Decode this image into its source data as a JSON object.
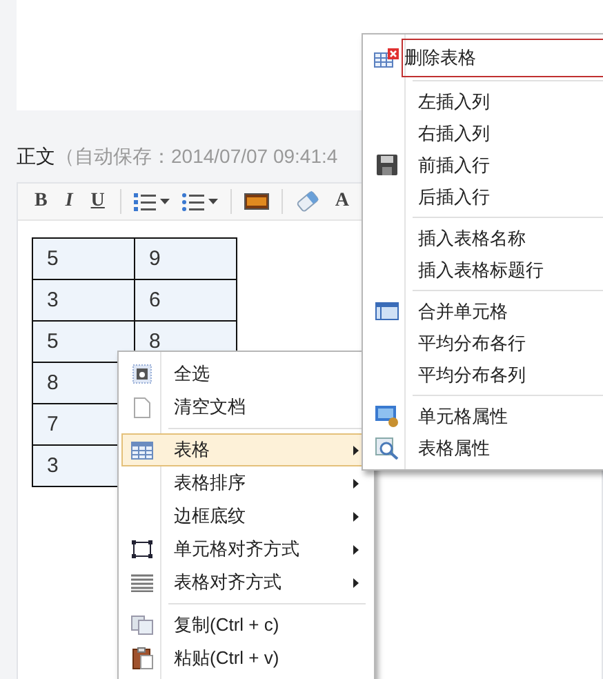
{
  "section": {
    "title": "正文",
    "autosave": "（自动保存：2014/07/07 09:41:4"
  },
  "toolbar": [
    {
      "kind": "text",
      "label": "B"
    },
    {
      "kind": "text",
      "label": "I"
    },
    {
      "kind": "text",
      "label": "U"
    },
    {
      "kind": "separator"
    },
    {
      "kind": "icon"
    },
    {
      "kind": "icon"
    },
    {
      "kind": "separator"
    },
    {
      "kind": "icon"
    },
    {
      "kind": "separator"
    },
    {
      "kind": "icon"
    },
    {
      "kind": "text",
      "label": "A"
    }
  ],
  "table": {
    "rows": [
      [
        "5",
        "9"
      ],
      [
        "3",
        "6"
      ],
      [
        "5",
        "8"
      ],
      [
        "8",
        ""
      ],
      [
        "7",
        ""
      ],
      [
        "3",
        ""
      ]
    ]
  },
  "context_menu": {
    "items": [
      {
        "kind": "item",
        "label": "全选",
        "submenu": false,
        "selected": false
      },
      {
        "kind": "item",
        "label": "清空文档",
        "submenu": false,
        "selected": false
      },
      {
        "kind": "separator"
      },
      {
        "kind": "item",
        "label": "表格",
        "submenu": true,
        "selected": true
      },
      {
        "kind": "item",
        "label": "表格排序",
        "submenu": true,
        "selected": false
      },
      {
        "kind": "item",
        "label": "边框底纹",
        "submenu": true,
        "selected": false
      },
      {
        "kind": "item",
        "label": "单元格对齐方式",
        "submenu": true,
        "selected": false
      },
      {
        "kind": "item",
        "label": "表格对齐方式",
        "submenu": true,
        "selected": false
      },
      {
        "kind": "separator"
      },
      {
        "kind": "item",
        "label": "复制(Ctrl + c)",
        "submenu": false,
        "selected": false
      },
      {
        "kind": "item",
        "label": "粘贴(Ctrl + v)",
        "submenu": false,
        "selected": false
      }
    ]
  },
  "submenu": {
    "items": [
      {
        "kind": "item",
        "label": "删除表格",
        "selected": true
      },
      {
        "kind": "separator"
      },
      {
        "kind": "item",
        "label": "左插入列",
        "selected": false
      },
      {
        "kind": "item",
        "label": "右插入列",
        "selected": false
      },
      {
        "kind": "item",
        "label": "前插入行",
        "selected": false
      },
      {
        "kind": "item",
        "label": "后插入行",
        "selected": false
      },
      {
        "kind": "separator"
      },
      {
        "kind": "item",
        "label": "插入表格名称",
        "selected": false
      },
      {
        "kind": "item",
        "label": "插入表格标题行",
        "selected": false
      },
      {
        "kind": "separator"
      },
      {
        "kind": "item",
        "label": "合并单元格",
        "selected": false
      },
      {
        "kind": "item",
        "label": "平均分布各行",
        "selected": false
      },
      {
        "kind": "item",
        "label": "平均分布各列",
        "selected": false
      },
      {
        "kind": "separator"
      },
      {
        "kind": "item",
        "label": "单元格属性",
        "selected": false
      },
      {
        "kind": "item",
        "label": "表格属性",
        "selected": false
      }
    ]
  }
}
